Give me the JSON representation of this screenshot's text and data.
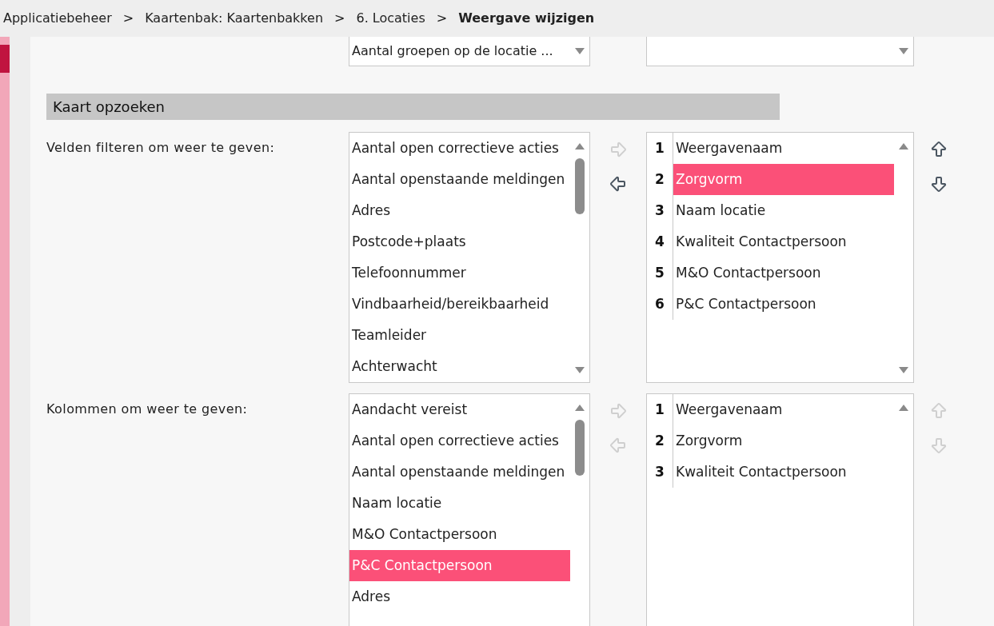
{
  "breadcrumb": [
    {
      "label": "Applicatiebeheer",
      "current": false
    },
    {
      "label": "Kaartenbak: Kaartenbakken",
      "current": false
    },
    {
      "label": "6. Locaties",
      "current": false
    },
    {
      "label": "Weergave wijzigen",
      "current": true
    }
  ],
  "breadcrumb_separator": ">",
  "top_selects": [
    {
      "kind": "dropdown",
      "value": "Aantal groepen op de locatie ..."
    },
    {
      "kind": "dropdown"
    }
  ],
  "section_title": "Kaart opzoeken",
  "rows": [
    {
      "label": "Velden filteren om weer te geven:",
      "available": [
        {
          "label": "Aantal open correctieve acties",
          "selected": false
        },
        {
          "label": "Aantal openstaande meldingen",
          "selected": false
        },
        {
          "label": "Adres",
          "selected": false
        },
        {
          "label": "Postcode+plaats",
          "selected": false
        },
        {
          "label": "Telefoonnummer",
          "selected": false
        },
        {
          "label": "Vindbaarheid/bereikbaarheid",
          "selected": false
        },
        {
          "label": "Teamleider",
          "selected": false
        },
        {
          "label": "Achterwacht",
          "selected": false
        }
      ],
      "add_disabled": true,
      "remove_disabled": false,
      "chosen": [
        {
          "number": "1",
          "label": "Weergavenaam",
          "selected": false
        },
        {
          "number": "2",
          "label": "Zorgvorm",
          "selected": true
        },
        {
          "number": "3",
          "label": "Naam locatie",
          "selected": false
        },
        {
          "number": "4",
          "label": "Kwaliteit Contactpersoon",
          "selected": false
        },
        {
          "number": "5",
          "label": "M&O Contactpersoon",
          "selected": false
        },
        {
          "number": "6",
          "label": "P&C Contactpersoon",
          "selected": false
        }
      ],
      "up_disabled": false,
      "down_disabled": false
    },
    {
      "label": "Kolommen om weer te geven:",
      "available": [
        {
          "label": "Aandacht vereist",
          "selected": false
        },
        {
          "label": "Aantal open correctieve acties",
          "selected": false
        },
        {
          "label": "Aantal openstaande meldingen",
          "selected": false
        },
        {
          "label": "Naam locatie",
          "selected": false
        },
        {
          "label": "M&O Contactpersoon",
          "selected": false
        },
        {
          "label": "P&C Contactpersoon",
          "selected": true
        },
        {
          "label": "Adres",
          "selected": false
        }
      ],
      "add_disabled": true,
      "remove_disabled": true,
      "chosen": [
        {
          "number": "1",
          "label": "Weergavenaam",
          "selected": false
        },
        {
          "number": "2",
          "label": "Zorgvorm",
          "selected": false
        },
        {
          "number": "3",
          "label": "Kwaliteit Contactpersoon",
          "selected": false
        }
      ],
      "up_disabled": true,
      "down_disabled": true
    }
  ]
}
